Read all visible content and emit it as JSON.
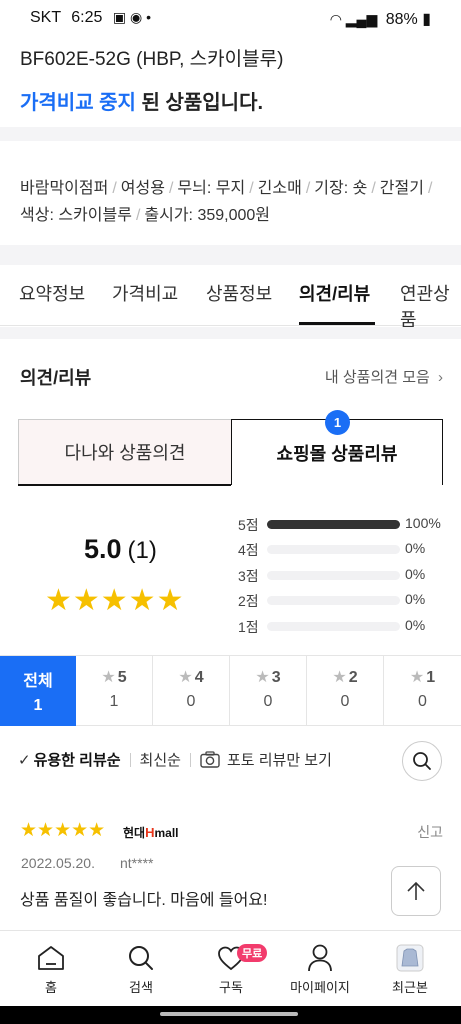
{
  "status_bar": {
    "carrier": "SKT",
    "time": "6:25",
    "battery": "88%"
  },
  "product": {
    "title_line": "BF602E-52G (HBP, 스카이블루)",
    "price_compare_label": "가격비교 중지",
    "price_compare_suffix": " 된 상품입니다.",
    "specs": [
      "바람막이점퍼",
      "여성용",
      "무늬: 무지",
      "긴소매",
      "기장: 숏",
      "간절기",
      "색상: 스카이블루",
      "출시가: 359,000원"
    ]
  },
  "tabs": [
    "요약정보",
    "가격비교",
    "상품정보",
    "의견/리뷰",
    "연관상품"
  ],
  "active_tab": "의견/리뷰",
  "section": {
    "title": "의견/리뷰",
    "my_opinions_link": "내 상품의견 모음"
  },
  "review_tabs": {
    "danawa": "다나와 상품의견",
    "mall": "쇼핑몰 상품리뷰",
    "mall_count_badge": "1"
  },
  "rating": {
    "score": "5.0",
    "count": "(1)",
    "stars": "★★★★★",
    "distribution": [
      {
        "label": "5점",
        "fraction": 1.0,
        "pct": "100%"
      },
      {
        "label": "4점",
        "fraction": 0.0,
        "pct": "0%"
      },
      {
        "label": "3점",
        "fraction": 0.0,
        "pct": "0%"
      },
      {
        "label": "2점",
        "fraction": 0.0,
        "pct": "0%"
      },
      {
        "label": "1점",
        "fraction": 0.0,
        "pct": "0%"
      }
    ]
  },
  "filters": [
    {
      "label": "전체",
      "count": "1"
    },
    {
      "label": "5",
      "count": "1"
    },
    {
      "label": "4",
      "count": "0"
    },
    {
      "label": "3",
      "count": "0"
    },
    {
      "label": "2",
      "count": "0"
    },
    {
      "label": "1",
      "count": "0"
    }
  ],
  "sort": {
    "helpful": "유용한 리뷰순",
    "latest": "최신순",
    "photo_only": "포토 리뷰만 보기"
  },
  "review": {
    "stars": "★★★★★",
    "mall_prefix": "현대",
    "mall_h": "H",
    "mall_suffix": "mall",
    "report": "신고",
    "date": "2022.05.20.",
    "user": "nt****",
    "text": "상품 품질이 좋습니다. 마음에 들어요!"
  },
  "bottom_nav": {
    "home": "홈",
    "search": "검색",
    "subscribe": "구독",
    "free_badge": "무료",
    "mypage": "마이페이지",
    "recent": "최근본"
  },
  "colors": {
    "accent": "#1a6ef5",
    "star": "#f6c000",
    "badge_pink": "#f23b6c"
  }
}
